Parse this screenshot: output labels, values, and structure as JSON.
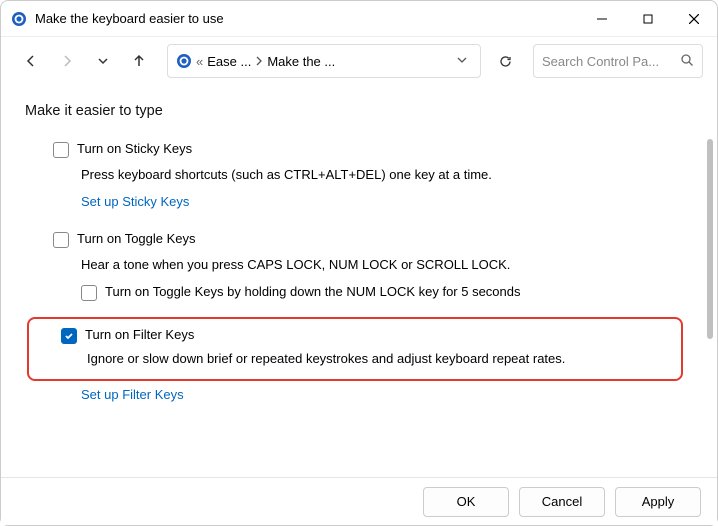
{
  "window": {
    "title": "Make the keyboard easier to use"
  },
  "breadcrumb": {
    "seg1": "Ease ...",
    "seg2": "Make the ..."
  },
  "search": {
    "placeholder": "Search Control Pa..."
  },
  "heading": "Make it easier to type",
  "sticky": {
    "label": "Turn on Sticky Keys",
    "desc": "Press keyboard shortcuts (such as CTRL+ALT+DEL) one key at a time.",
    "link": "Set up Sticky Keys"
  },
  "toggle": {
    "label": "Turn on Toggle Keys",
    "desc": "Hear a tone when you press CAPS LOCK, NUM LOCK or SCROLL LOCK.",
    "sub_label": "Turn on Toggle Keys by holding down the NUM LOCK key for 5 seconds"
  },
  "filter": {
    "label": "Turn on Filter Keys",
    "desc": "Ignore or slow down brief or repeated keystrokes and adjust keyboard repeat rates.",
    "link": "Set up Filter Keys"
  },
  "buttons": {
    "ok": "OK",
    "cancel": "Cancel",
    "apply": "Apply"
  }
}
